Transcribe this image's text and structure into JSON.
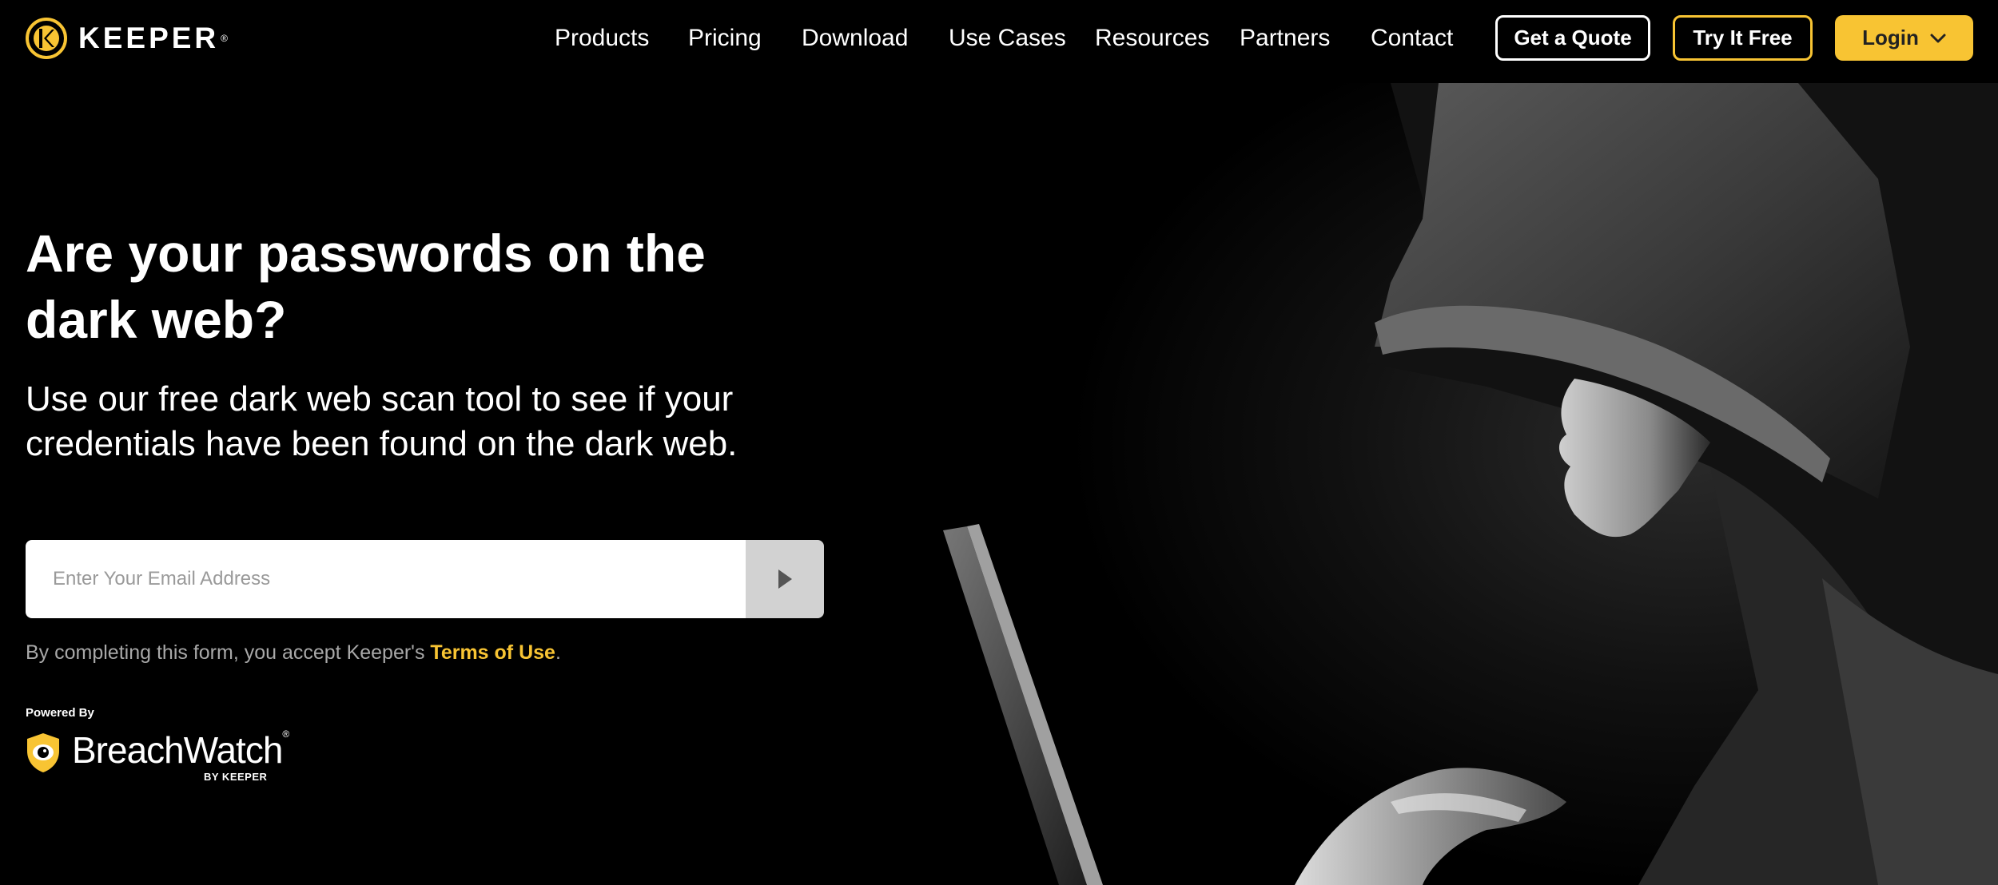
{
  "header": {
    "logo_text": "KEEPER",
    "logo_icon": "keeper-logo-icon",
    "nav": [
      {
        "label": "Products"
      },
      {
        "label": "Pricing"
      },
      {
        "label": "Download"
      },
      {
        "label": "Use Cases"
      },
      {
        "label": "Resources"
      },
      {
        "label": "Partners"
      },
      {
        "label": "Contact"
      }
    ],
    "quote_label": "Get a Quote",
    "try_label": "Try It Free",
    "login_label": "Login"
  },
  "hero": {
    "headline": "Are your passwords on the dark web?",
    "subhead": "Use our free dark web scan tool to see if your credentials have been found on the dark web.",
    "image_description_icon": "hooded-figure-image"
  },
  "form": {
    "email_placeholder": "Enter Your Email Address",
    "submit_icon": "play-arrow-icon",
    "terms_prefix": "By completing this form, you accept Keeper's ",
    "terms_link": "Terms of Use",
    "terms_suffix": "."
  },
  "branding": {
    "powered_by": "Powered By",
    "breachwatch_name": "BreachWatch",
    "breachwatch_by": "BY KEEPER"
  },
  "colors": {
    "background": "#000000",
    "accent": "#f8c433",
    "text": "#ffffff",
    "muted_text": "#a8a8a8",
    "submit_bg": "#d2d2d2"
  }
}
